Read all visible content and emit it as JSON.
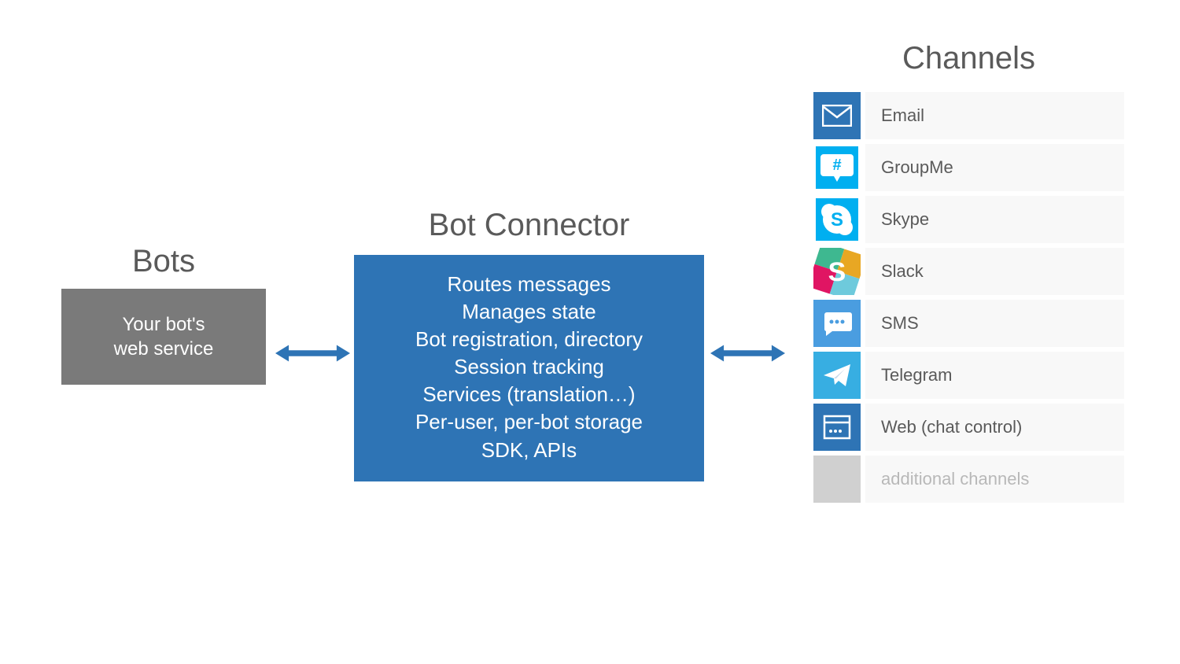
{
  "bots": {
    "title": "Bots",
    "box_line1": "Your bot's",
    "box_line2": "web service"
  },
  "connector": {
    "title": "Bot Connector",
    "lines": [
      "Routes messages",
      "Manages state",
      "Bot registration, directory",
      "Session tracking",
      "Services (translation…)",
      "Per-user, per-bot storage",
      "SDK, APIs"
    ]
  },
  "channels": {
    "title": "Channels",
    "items": [
      {
        "label": "Email",
        "icon": "email"
      },
      {
        "label": "GroupMe",
        "icon": "groupme"
      },
      {
        "label": "Skype",
        "icon": "skype"
      },
      {
        "label": "Slack",
        "icon": "slack"
      },
      {
        "label": "SMS",
        "icon": "sms"
      },
      {
        "label": "Telegram",
        "icon": "telegram"
      },
      {
        "label": "Web (chat control)",
        "icon": "web"
      },
      {
        "label": "additional channels",
        "icon": "blank",
        "disabled": true
      }
    ]
  }
}
